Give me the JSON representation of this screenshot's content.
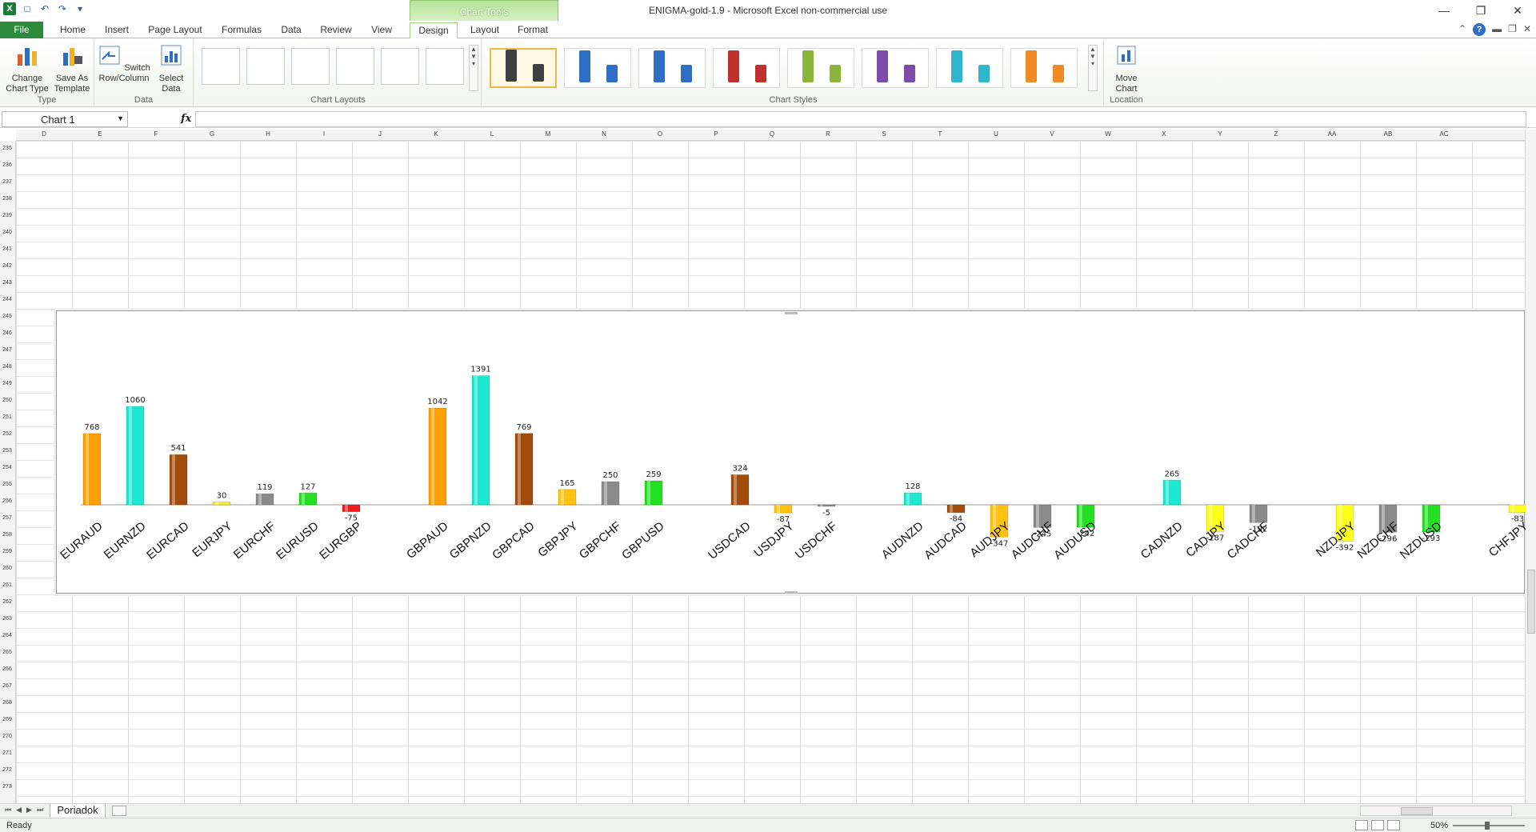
{
  "window": {
    "title": "ENIGMA-gold-1.9 -  Microsoft Excel non-commercial use",
    "context_tools": "Chart Tools"
  },
  "ribbon": {
    "tabs": [
      "File",
      "Home",
      "Insert",
      "Page Layout",
      "Formulas",
      "Data",
      "Review",
      "View",
      "Design",
      "Layout",
      "Format"
    ],
    "active_tab": "Design",
    "groups": {
      "type": {
        "label": "Type",
        "change_chart_type": "Change Chart Type",
        "save_as_template": "Save As Template"
      },
      "data": {
        "label": "Data",
        "switch_row_column": "Switch Row/Column",
        "select_data": "Select Data"
      },
      "chart_layouts": {
        "label": "Chart Layouts"
      },
      "chart_styles": {
        "label": "Chart Styles",
        "colors": [
          "#404040",
          "#2e6fc4",
          "#2e6fc4",
          "#c0302c",
          "#8cb43a",
          "#7d4ca8",
          "#2fb6cc",
          "#f08a24"
        ]
      },
      "location": {
        "label": "Location",
        "move_chart": "Move Chart"
      }
    }
  },
  "formula_bar": {
    "name_box": "Chart 1",
    "fx": "fx",
    "value": ""
  },
  "columns": [
    "D",
    "E",
    "F",
    "G",
    "H",
    "I",
    "J",
    "K",
    "L",
    "M",
    "N",
    "O",
    "P",
    "Q",
    "R",
    "S",
    "T",
    "U",
    "V",
    "W",
    "X",
    "Y",
    "Z",
    "AA",
    "AB",
    "AC"
  ],
  "rows": [
    "235",
    "236",
    "237",
    "238",
    "239",
    "240",
    "241",
    "242",
    "243",
    "244",
    "245",
    "246",
    "247",
    "248",
    "249",
    "250",
    "251",
    "252",
    "253",
    "254",
    "255",
    "256",
    "257",
    "258",
    "259",
    "260",
    "261",
    "262",
    "263",
    "264",
    "265",
    "266",
    "267",
    "268",
    "269",
    "270",
    "271",
    "272",
    "273"
  ],
  "chart_data": {
    "type": "bar",
    "categories": [
      "EURAUD",
      "EURNZD",
      "EURCAD",
      "EURJPY",
      "EURCHF",
      "EURUSD",
      "EURGBP",
      "",
      "GBPAUD",
      "GBPNZD",
      "GBPCAD",
      "GBPJPY",
      "GBPCHF",
      "GBPUSD",
      "",
      "USDCAD",
      "USDJPY",
      "USDCHF",
      "",
      "AUDNZD",
      "AUDCAD",
      "AUDJPY",
      "AUDCHF",
      "AUDUSD",
      "",
      "CADNZD",
      "CADJPY",
      "CADCHF",
      "",
      "NZDJPY",
      "NZDCHF",
      "NZDUSD",
      "",
      "CHFJPY"
    ],
    "values": [
      768,
      1060,
      541,
      30,
      119,
      127,
      -75,
      null,
      1042,
      1391,
      769,
      165,
      250,
      259,
      null,
      324,
      -87,
      -5,
      null,
      128,
      -84,
      -347,
      -245,
      -242,
      null,
      265,
      -287,
      -192,
      null,
      -392,
      -296,
      -293,
      null,
      -83
    ],
    "labels": [
      "768",
      "1060",
      "541",
      "30",
      "119",
      "127",
      "-75",
      "",
      "1042",
      "1391",
      "769",
      "165",
      "250",
      "259",
      "",
      "324",
      "-87",
      "-5",
      "",
      "128",
      "-84",
      "-347",
      "-245",
      "-242",
      "",
      "265",
      "-287",
      "-192",
      "",
      "-392",
      "-296",
      "-293",
      "",
      "-83"
    ],
    "colors": [
      "#ffa000",
      "#1de8d0",
      "#a24c0c",
      "#f2ee3a",
      "#8a8a8a",
      "#22e022",
      "#ee1c1c",
      "",
      "#ffa000",
      "#1de8d0",
      "#a24c0c",
      "#ffc20e",
      "#8a8a8a",
      "#22e022",
      "",
      "#a24c0c",
      "#ffc20e",
      "#8a8a8a",
      "",
      "#1de8d0",
      "#a24c0c",
      "#ffc20e",
      "#8a8a8a",
      "#22e022",
      "",
      "#1de8d0",
      "#ffff1a",
      "#8a8a8a",
      "",
      "#ffff1a",
      "#8a8a8a",
      "#22e022",
      "",
      "#ffff1a"
    ],
    "ylim": [
      -420,
      1450
    ],
    "grid": false,
    "legend": "none"
  },
  "sheets": {
    "active": "Poriadok"
  },
  "status": {
    "text": "Ready",
    "zoom": "50%"
  }
}
